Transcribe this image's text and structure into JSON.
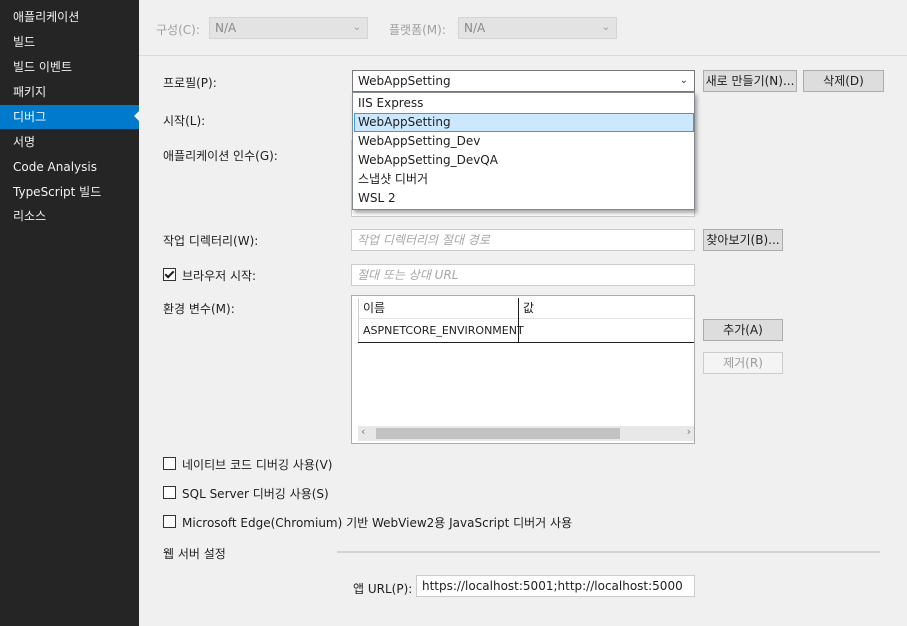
{
  "sidebar": {
    "items": [
      {
        "label": "애플리케이션"
      },
      {
        "label": "빌드"
      },
      {
        "label": "빌드 이벤트"
      },
      {
        "label": "패키지"
      },
      {
        "label": "디버그"
      },
      {
        "label": "서명"
      },
      {
        "label": "Code Analysis"
      },
      {
        "label": "TypeScript 빌드"
      },
      {
        "label": "리소스"
      }
    ],
    "active_index": 4
  },
  "topbar": {
    "configuration_label": "구성(C):",
    "configuration_value": "N/A",
    "platform_label": "플랫폼(M):",
    "platform_value": "N/A"
  },
  "profile": {
    "label": "프로필(P):",
    "value": "WebAppSetting",
    "new_button": "새로 만들기(N)...",
    "delete_button": "삭제(D)"
  },
  "dropdown": {
    "options": [
      "IIS Express",
      "WebAppSetting",
      "WebAppSetting_Dev",
      "WebAppSetting_DevQA",
      "스냅샷 디버거",
      "WSL 2"
    ],
    "selected_index": 1
  },
  "launch": {
    "label": "시작(L):"
  },
  "app_args": {
    "label": "애플리케이션 인수(G):"
  },
  "working_dir": {
    "label": "작업 디렉터리(W):",
    "placeholder": "작업 디렉터리의 절대 경로",
    "browse_button": "찾아보기(B)..."
  },
  "launch_browser": {
    "label": "브라우저 시작:",
    "checked": true,
    "placeholder": "절대 또는 상대 URL"
  },
  "env_vars": {
    "label": "환경 변수(M):",
    "columns": [
      "이름",
      "값"
    ],
    "rows": [
      {
        "name": "ASPNETCORE_ENVIRONMENT",
        "value": ""
      }
    ],
    "add_button": "추가(A)",
    "remove_button": "제거(R)"
  },
  "options": {
    "native_debug": "네이티브 코드 디버깅 사용(V)",
    "sql_debug": "SQL Server 디버깅 사용(S)",
    "webview2_debug": "Microsoft Edge(Chromium) 기반 WebView2용 JavaScript 디버거 사용"
  },
  "web_server": {
    "section_title": "웹 서버 설정",
    "app_url_label": "앱 URL(P):",
    "app_url_value": "https://localhost:5001;http://localhost:5000"
  },
  "colors": {
    "sidebar_bg": "#252526",
    "accent": "#007acc",
    "content_bg": "#f0f0f0",
    "dropdown_selected_bg": "#cce8ff",
    "dropdown_selected_border": "#3399ff"
  }
}
